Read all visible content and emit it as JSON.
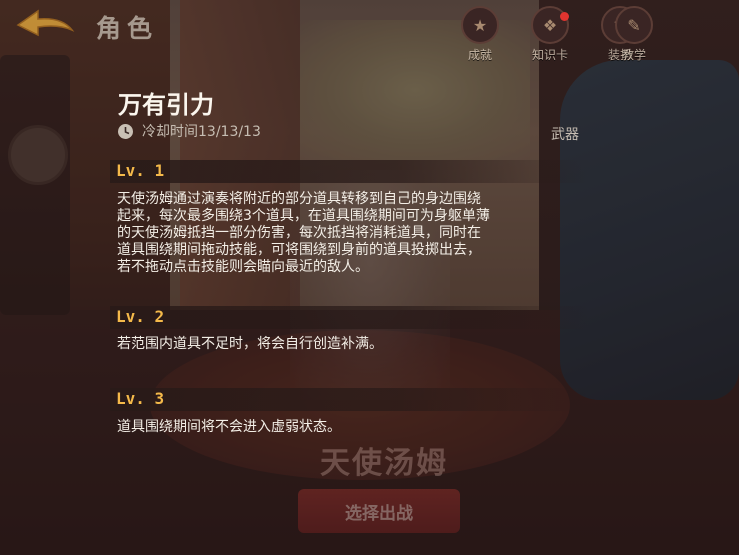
{
  "header": {
    "title": "角色",
    "back_icon": "back-arrow-icon"
  },
  "top_icons": [
    {
      "label": "成就",
      "icon": "achievement-icon",
      "badge": false
    },
    {
      "label": "知识卡",
      "icon": "knowledge-card-icon",
      "badge": true
    },
    {
      "label": "装扮",
      "icon": "outfit-icon",
      "badge": false
    },
    {
      "label": "教学",
      "icon": "tutorial-icon",
      "badge": false
    }
  ],
  "skill": {
    "name": "万有引力",
    "cooldown": "冷却时间13/13/13",
    "type": "武器",
    "levels": [
      {
        "label": "Lv. 1",
        "description": [
          "天使汤姆通过演奏将附近的部分道具转移到自己的身边围绕",
          "起来，每次最多围绕3个道具，在道具围绕期间可为身躯单薄",
          "的天使汤姆抵挡一部分伤害，每次抵挡将消耗道具，同时在",
          "道具围绕期间拖动技能，可将围绕到身前的道具投掷出去，",
          "若不拖动点击技能则会瞄向最近的敌人。"
        ]
      },
      {
        "label": "Lv. 2",
        "description": [
          "若范围内道具不足时，将会自行创造补满。"
        ]
      },
      {
        "label": "Lv. 3",
        "description": [
          "道具围绕期间将不会进入虚弱状态。"
        ]
      }
    ]
  },
  "character": {
    "name": "天使汤姆"
  },
  "actions": {
    "select_label": "选择出战"
  },
  "colors": {
    "level_label": "#f4b94a",
    "badge": "#e0342f",
    "button": "#8c2d2a"
  }
}
